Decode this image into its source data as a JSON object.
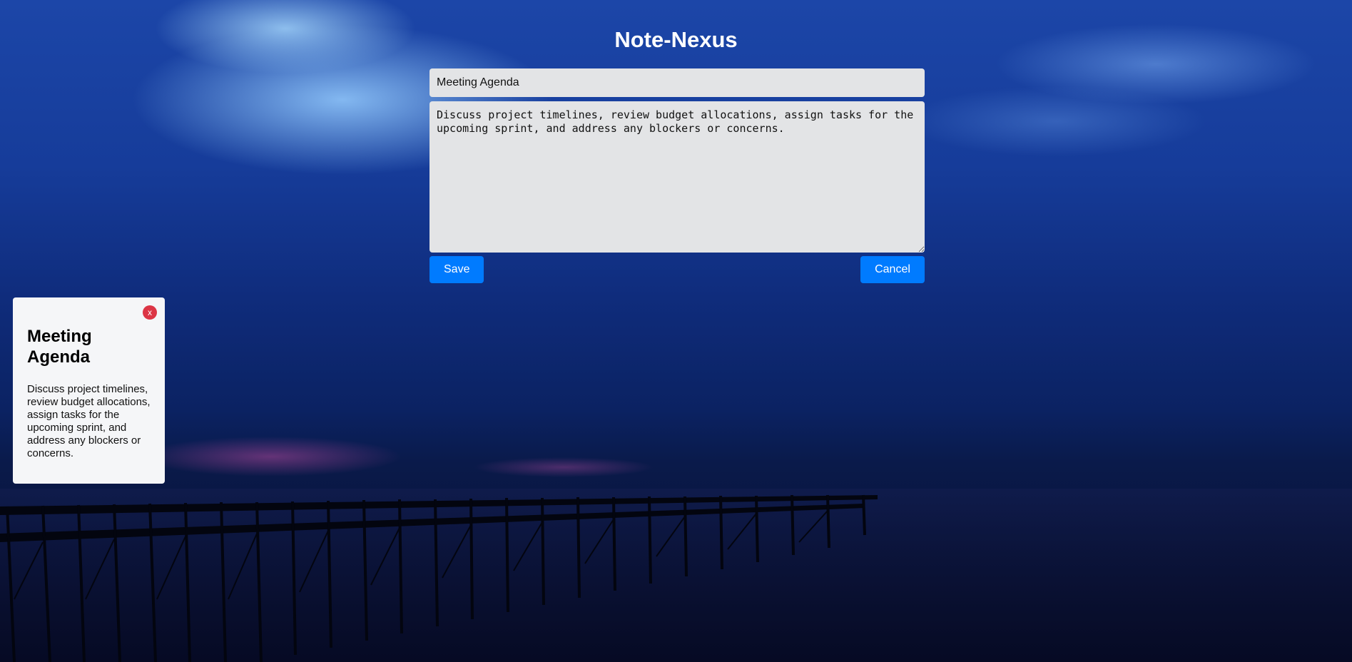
{
  "app": {
    "title": "Note-Nexus"
  },
  "editor": {
    "title_value": "Meeting Agenda",
    "body_value": "Discuss project timelines, review budget allocations, assign tasks for the upcoming sprint, and address any blockers or concerns.",
    "save_label": "Save",
    "cancel_label": "Cancel"
  },
  "notes": [
    {
      "title": "Meeting Agenda",
      "body": "Discuss project timelines, review budget allocations, assign tasks for the upcoming sprint, and address any blockers or concerns.",
      "close_label": "x"
    }
  ],
  "colors": {
    "primary_button": "#007bff",
    "delete_button": "#dc3545",
    "note_background": "#f5f6f8",
    "input_background": "#e3e4e6"
  },
  "icons": {
    "close": "close-icon"
  }
}
